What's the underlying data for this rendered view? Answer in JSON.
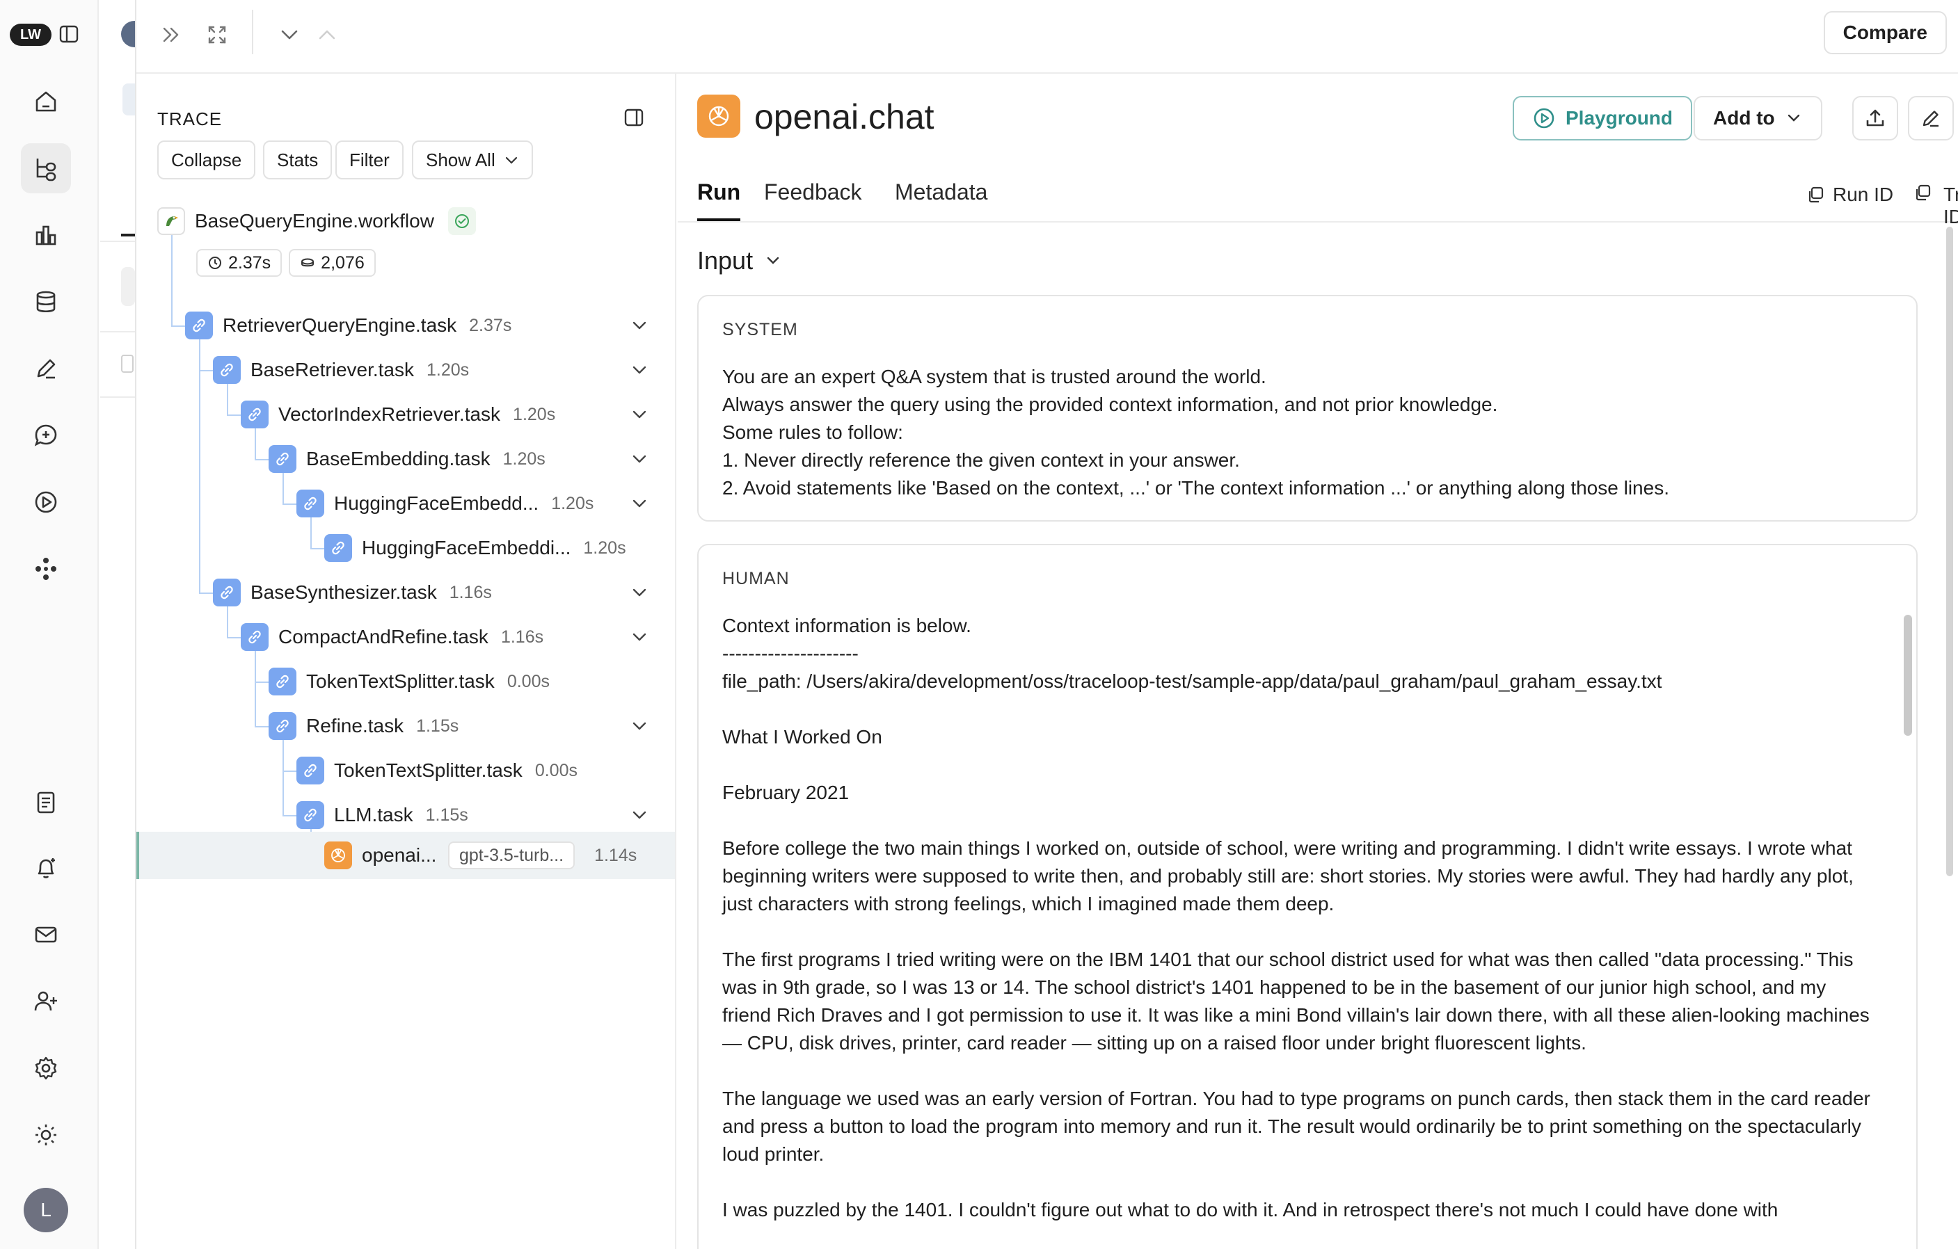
{
  "rail": {
    "logo": "LW",
    "items": [
      "home-icon",
      "traces-icon",
      "dashboards-icon",
      "datasets-icon",
      "annotations-icon",
      "prompts-icon",
      "playground-icon",
      "deployments-icon",
      "docs-icon",
      "alerts-icon",
      "mail-icon",
      "invite-user-icon",
      "settings-icon",
      "theme-icon"
    ],
    "avatar": "L"
  },
  "topbar": {
    "compare_label": "Compare"
  },
  "trace": {
    "title": "TRACE",
    "buttons": {
      "collapse": "Collapse",
      "stats": "Stats",
      "filter": "Filter",
      "show_all": "Show All"
    },
    "root": {
      "name": "BaseQueryEngine.workflow",
      "duration": "2.37s",
      "tokens": "2,076"
    },
    "nodes": [
      {
        "name": "RetrieverQueryEngine.task",
        "duration": "2.37s"
      },
      {
        "name": "BaseRetriever.task",
        "duration": "1.20s"
      },
      {
        "name": "VectorIndexRetriever.task",
        "duration": "1.20s"
      },
      {
        "name": "BaseEmbedding.task",
        "duration": "1.20s"
      },
      {
        "name": "HuggingFaceEmbedd...",
        "duration": "1.20s"
      },
      {
        "name": "HuggingFaceEmbeddi...",
        "duration": "1.20s"
      },
      {
        "name": "BaseSynthesizer.task",
        "duration": "1.16s"
      },
      {
        "name": "CompactAndRefine.task",
        "duration": "1.16s"
      },
      {
        "name": "TokenTextSplitter.task",
        "duration": "0.00s"
      },
      {
        "name": "Refine.task",
        "duration": "1.15s"
      },
      {
        "name": "TokenTextSplitter.task",
        "duration": "0.00s"
      },
      {
        "name": "LLM.task",
        "duration": "1.15s"
      }
    ],
    "selected": {
      "name": "openai...",
      "model": "gpt-3.5-turb...",
      "duration": "1.14s"
    }
  },
  "details": {
    "title": "openai.chat",
    "playground_label": "Playground",
    "add_to_label": "Add to",
    "tabs": [
      "Run",
      "Feedback",
      "Metadata"
    ],
    "run_id_label": "Run ID",
    "trace_id_label": "Trace ID",
    "section": "Input",
    "system": {
      "role": "SYSTEM",
      "text": "You are an expert Q&A system that is trusted around the world.\nAlways answer the query using the provided context information, and not prior knowledge.\nSome rules to follow:\n1. Never directly reference the given context in your answer.\n2. Avoid statements like 'Based on the context, ...' or 'The context information ...' or anything along those lines."
    },
    "human": {
      "role": "HUMAN",
      "text": "Context information is below.\n---------------------\nfile_path: /Users/akira/development/oss/traceloop-test/sample-app/data/paul_graham/paul_graham_essay.txt\n\nWhat I Worked On\n\nFebruary 2021\n\nBefore college the two main things I worked on, outside of school, were writing and programming. I didn't write essays. I wrote what beginning writers were supposed to write then, and probably still are: short stories. My stories were awful. They had hardly any plot, just characters with strong feelings, which I imagined made them deep.\n\nThe first programs I tried writing were on the IBM 1401 that our school district used for what was then called \"data processing.\" This was in 9th grade, so I was 13 or 14. The school district's 1401 happened to be in the basement of our junior high school, and my friend Rich Draves and I got permission to use it. It was like a mini Bond villain's lair down there, with all these alien-looking machines — CPU, disk drives, printer, card reader — sitting up on a raised floor under bright fluorescent lights.\n\nThe language we used was an early version of Fortran. You had to type programs on punch cards, then stack them in the card reader and press a button to load the program into memory and run it. The result would ordinarily be to print something on the spectacularly loud printer.\n\nI was puzzled by the 1401. I couldn't figure out what to do with it. And in retrospect there's not much I could have done with"
    }
  },
  "colors": {
    "accent": "#2f8f8a",
    "tree_line": "#b7d1f4",
    "node_icon": "#7aa6f0",
    "openai": "#f29a3f"
  }
}
